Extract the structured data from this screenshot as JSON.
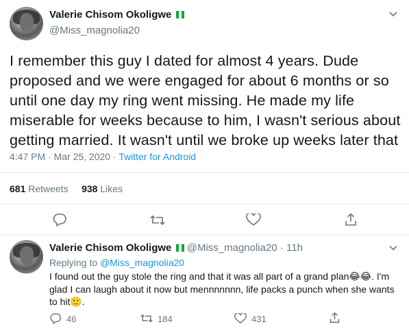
{
  "main_tweet": {
    "name": "Valerie Chisom Okoligwe",
    "handle": "@Miss_magnolia20",
    "text": "I remember this guy I dated for almost 4 years. Dude proposed and we were engaged for about 6 months or so until one day my ring went missing. He made my life miserable for weeks because to him, I wasn't serious about getting married. It wasn't until we broke up weeks later that",
    "time_date": "4:47 PM · Mar 25, 2020 · ",
    "source": "Twitter for Android",
    "retweets_count": "681",
    "retweets_label": "Retweets",
    "likes_count": "938",
    "likes_label": "Likes"
  },
  "reply_tweet": {
    "name": "Valerie Chisom Okoligwe",
    "handle_time": "@Miss_magnolia20 · 11h",
    "replying_prefix": "Replying to ",
    "replying_to": "@Miss_magnolia20",
    "text_part1": "I found out the guy stole the ring and that it was all part of a grand plan",
    "emoji_laugh": "😂😂",
    "text_part2": ". I'm glad I can laugh about it now but mennnnnnn, life packs a punch when she wants to hit",
    "emoji_smile": "🙂",
    "text_part3": ".",
    "reply_count": "46",
    "retweet_count": "184",
    "like_count": "431"
  },
  "icons": [
    "chevron-down-icon",
    "reply-icon",
    "retweet-icon",
    "like-icon",
    "share-icon",
    "flag-icon"
  ],
  "colors": {
    "link": "#1b95e0",
    "muted": "#657786",
    "text": "#14171a",
    "flag_green": "#13a538"
  }
}
